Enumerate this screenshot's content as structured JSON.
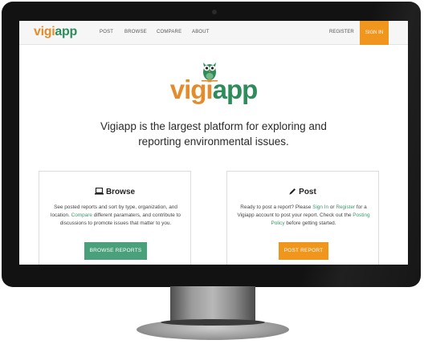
{
  "nav": {
    "logo_vigi": "vigi",
    "logo_app": "app",
    "links": [
      "POST",
      "BROWSE",
      "COMPARE",
      "ABOUT"
    ],
    "register": "REGISTER",
    "signin": "SIGN IN"
  },
  "hero": {
    "logo_vigi": "vigi",
    "logo_app": "app",
    "tagline_line1": "Vigiapp is the largest platform for exploring and",
    "tagline_line2": "reporting environmental issues."
  },
  "browse": {
    "title": "Browse",
    "text_a": "See posted reports and sort by type, organization, and location. ",
    "text_link": "Compare",
    "text_b": " different paramaters, and contribute to discussions to promote issues that matter to you.",
    "button": "BROWSE REPORTS"
  },
  "post": {
    "title": "Post",
    "text_a": "Ready to post a report? Please ",
    "link_signin": "Sign In",
    "text_b": " or ",
    "link_register": "Register",
    "text_c": " for a Vigiapp account to post your report. Check out the ",
    "link_policy": "Posting Policy",
    "text_d": " before getting started.",
    "button": "POST REPORT"
  },
  "colors": {
    "orange": "#f0961d",
    "green": "#2e8c5a",
    "button_green": "#4aa07a"
  },
  "icons": [
    "laptop-icon",
    "pencil-icon",
    "owl-logo-icon"
  ]
}
